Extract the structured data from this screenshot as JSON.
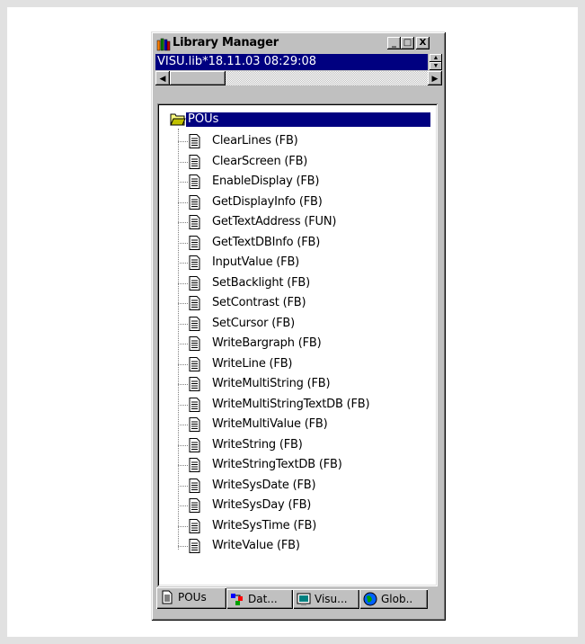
{
  "window": {
    "title": "Library Manager",
    "minimize_glyph": "_",
    "maximize_glyph": "□",
    "close_glyph": "X",
    "address": "VISU.lib*18.11.03 08:29:08"
  },
  "tree": {
    "root_label": "POUs",
    "items": [
      "ClearLines (FB)",
      "ClearScreen (FB)",
      "EnableDisplay (FB)",
      "GetDisplayInfo (FB)",
      "GetTextAddress (FUN)",
      "GetTextDBInfo (FB)",
      "InputValue (FB)",
      "SetBacklight (FB)",
      "SetContrast (FB)",
      "SetCursor (FB)",
      "WriteBargraph (FB)",
      "WriteLine (FB)",
      "WriteMultiString (FB)",
      "WriteMultiStringTextDB (FB)",
      "WriteMultiValue (FB)",
      "WriteString (FB)",
      "WriteStringTextDB (FB)",
      "WriteSysDate (FB)",
      "WriteSysDay (FB)",
      "WriteSysTime (FB)",
      "WriteValue (FB)"
    ]
  },
  "tabs": [
    {
      "label": "POUs",
      "icon": "document-icon",
      "active": true
    },
    {
      "label": "Dat...",
      "icon": "data-types-icon",
      "active": false
    },
    {
      "label": "Visu...",
      "icon": "visualization-icon",
      "active": false
    },
    {
      "label": "Glob..",
      "icon": "globe-icon",
      "active": false
    }
  ],
  "colors": {
    "selection": "#000080",
    "face": "#c0c0c0"
  }
}
